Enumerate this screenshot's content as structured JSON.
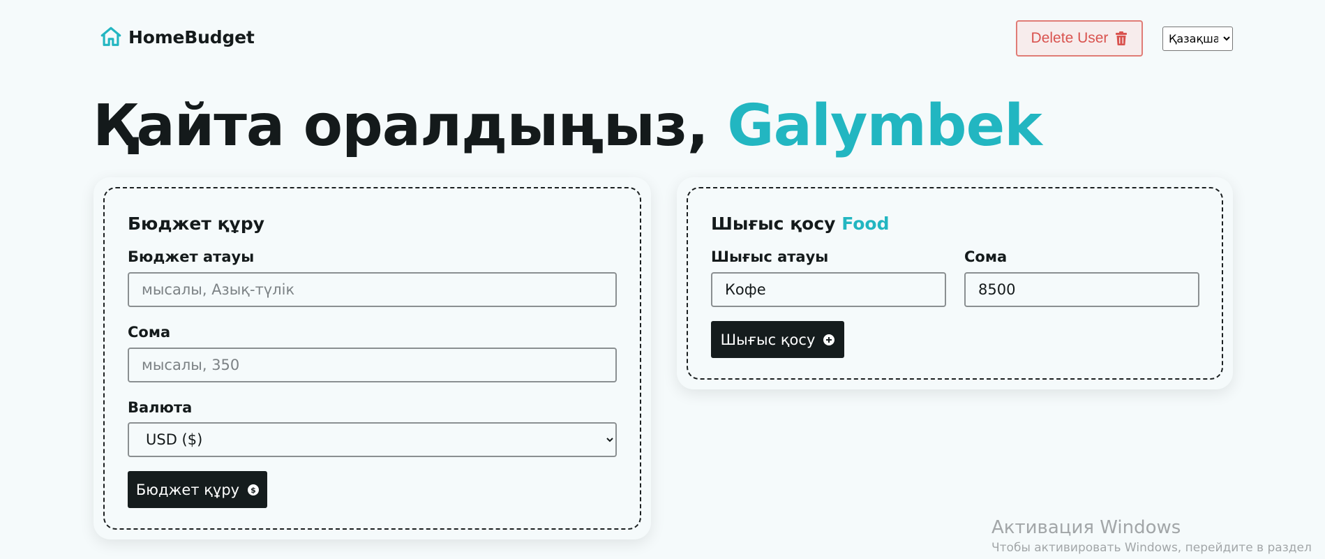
{
  "nav": {
    "brand": "HomeBudget",
    "delete_button": "Delete User",
    "language": {
      "selected": "Қазақша"
    }
  },
  "hero": {
    "greeting": "Қайта оралдыңыз,",
    "username": "Galymbek"
  },
  "budget_form": {
    "title": "Бюджет құру",
    "name_label": "Бюджет атауы",
    "name_placeholder": "мысалы, Азық-түлік",
    "amount_label": "Сома",
    "amount_placeholder": "мысалы, 350",
    "currency_label": "Валюта",
    "currency_selected": "USD ($)",
    "submit_label": "Бюджет құру"
  },
  "expense_form": {
    "title": "Шығыс қосу",
    "budget_name": "Food",
    "name_label": "Шығыс атауы",
    "name_value": "Кофе",
    "amount_label": "Сома",
    "amount_value": "8500",
    "submit_label": "Шығыс қосу"
  },
  "watermark": {
    "title": "Активация Windows",
    "subtitle": "Чтобы активировать Windows, перейдите в раздел"
  },
  "colors": {
    "accent": "#22b6c1",
    "dark": "#151c1d",
    "danger": "#d9534f",
    "background": "#f5fafb"
  }
}
